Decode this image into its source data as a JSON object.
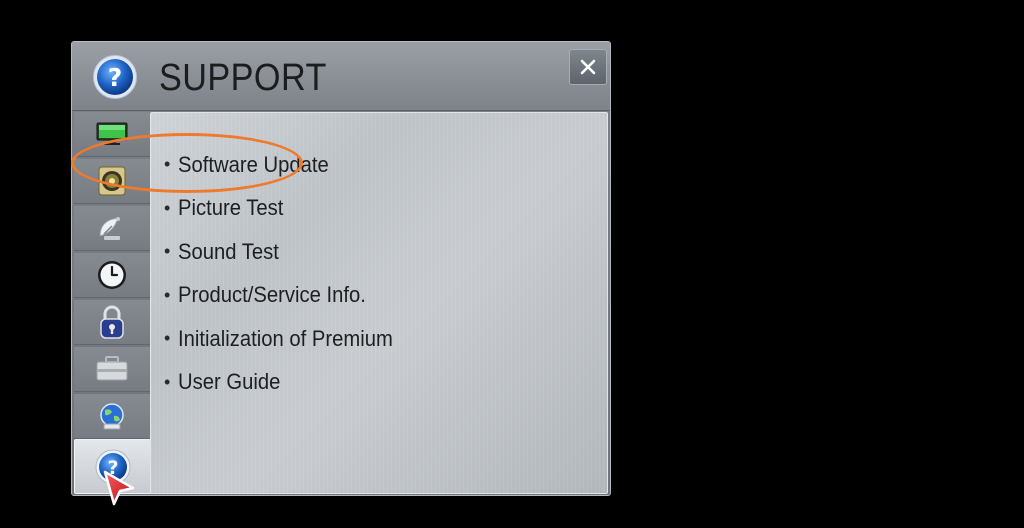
{
  "window": {
    "title": "SUPPORT",
    "title_icon": "question-circle-icon",
    "close_label": "✕"
  },
  "sidebar": {
    "items": [
      {
        "icon": "picture-monitor-icon",
        "active": false
      },
      {
        "icon": "audio-speaker-icon",
        "active": false
      },
      {
        "icon": "satellite-dish-icon",
        "active": false
      },
      {
        "icon": "clock-icon",
        "active": false
      },
      {
        "icon": "padlock-icon",
        "active": false
      },
      {
        "icon": "toolbox-icon",
        "active": false
      },
      {
        "icon": "network-globe-icon",
        "active": false
      },
      {
        "icon": "question-circle-icon",
        "active": true
      }
    ]
  },
  "menu": {
    "bullet": "•",
    "items": [
      {
        "label": "Software Update",
        "highlighted": true
      },
      {
        "label": "Picture Test"
      },
      {
        "label": "Sound Test"
      },
      {
        "label": "Product/Service Info."
      },
      {
        "label": "Initialization of Premium"
      },
      {
        "label": "User Guide"
      }
    ]
  },
  "colors": {
    "highlight_ellipse": "#ee7a2c",
    "pointer": "#d8232f",
    "icon_blue": "#1e63c4"
  }
}
